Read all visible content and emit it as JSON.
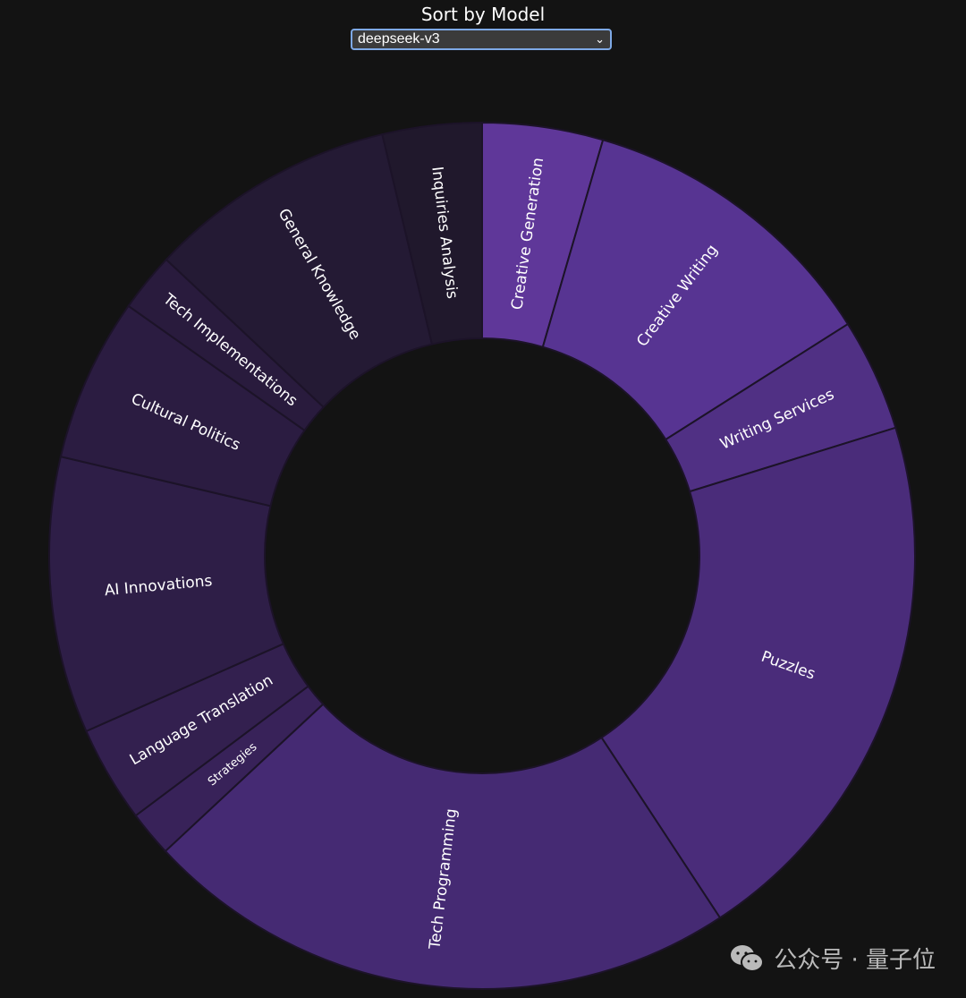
{
  "header": {
    "title": "Sort by Model",
    "selected_model": "deepseek-v3"
  },
  "watermark": {
    "text": "公众号 · 量子位"
  },
  "colors": {
    "background": "#131313",
    "segment_border": "#1c1328"
  },
  "chart_data": {
    "type": "donut",
    "start_angle_deg": 0,
    "direction": "clockwise",
    "segments": [
      {
        "label": "Creative Generation",
        "value": 4.5,
        "color": "#5f3799"
      },
      {
        "label": "Creative Writing",
        "value": 11.5,
        "color": "#573492"
      },
      {
        "label": "Writing Services",
        "value": 4.2,
        "color": "#503084"
      },
      {
        "label": "Puzzles",
        "value": 20.5,
        "color": "#4a2c7a"
      },
      {
        "label": "Tech Programming",
        "value": 22.3,
        "color": "#452a73"
      },
      {
        "label": "Strategies",
        "value": 1.7,
        "color": "#382259"
      },
      {
        "label": "Language Translation",
        "value": 3.6,
        "color": "#33204f"
      },
      {
        "label": "AI Innovations",
        "value": 10.3,
        "color": "#2e1e47"
      },
      {
        "label": "Cultural Politics",
        "value": 6.1,
        "color": "#2b1c41"
      },
      {
        "label": "Tech Implementations",
        "value": 2.2,
        "color": "#291b3d"
      },
      {
        "label": "General Knowledge",
        "value": 9.3,
        "color": "#241a34"
      },
      {
        "label": "Inquiries Analysis",
        "value": 3.7,
        "color": "#20182c"
      }
    ]
  }
}
